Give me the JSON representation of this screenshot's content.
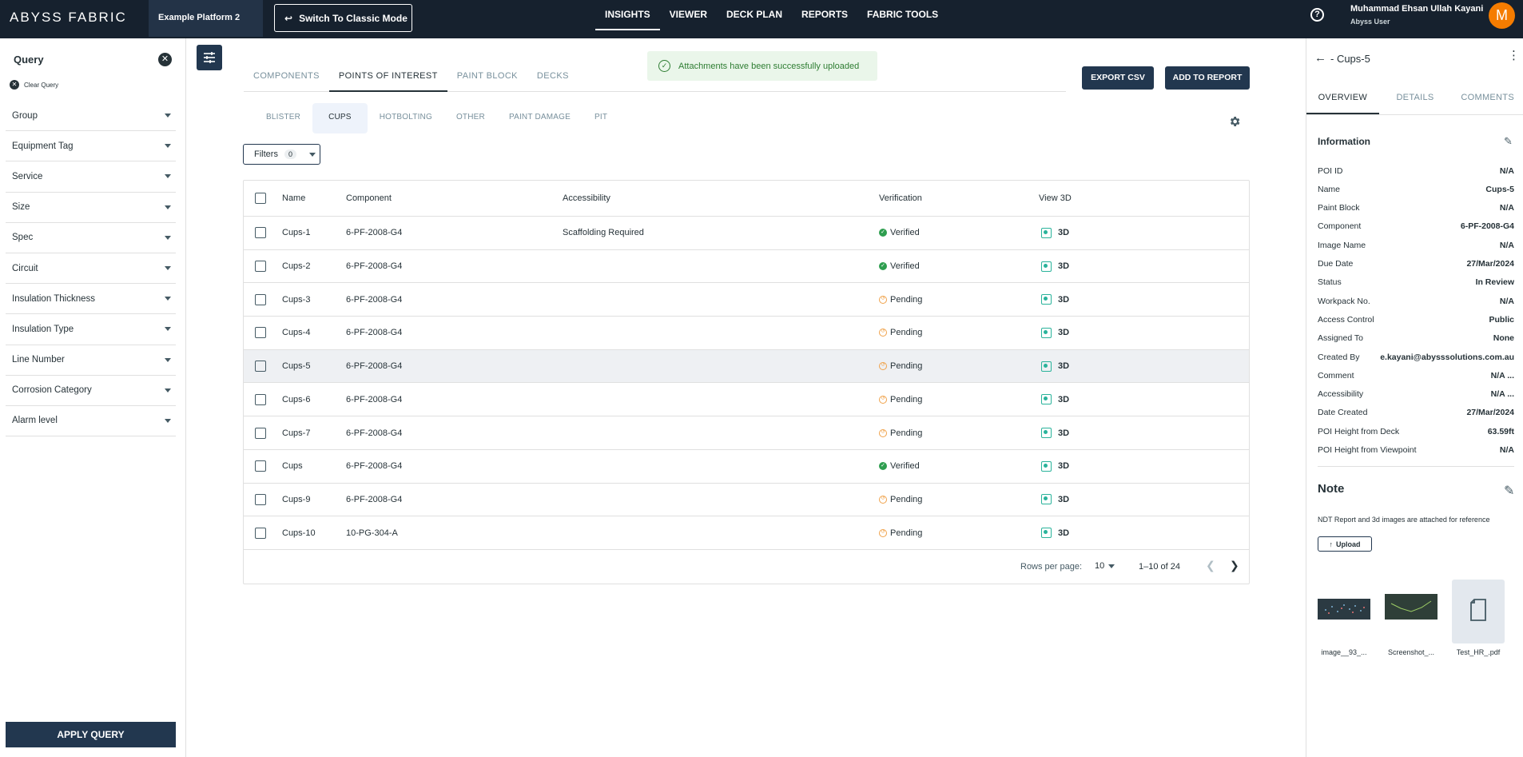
{
  "header": {
    "logo": "ABYSS FABRIC",
    "platform": "Example Platform 2",
    "classic_mode": "Switch To Classic Mode",
    "nav": [
      "INSIGHTS",
      "VIEWER",
      "DECK PLAN",
      "REPORTS",
      "FABRIC TOOLS"
    ],
    "nav_active": "INSIGHTS",
    "help": "?",
    "user_name": "Muhammad Ehsan Ullah Kayani",
    "user_role": "Abyss User",
    "avatar_letter": "M"
  },
  "query": {
    "title": "Query",
    "clear_label": "Clear Query",
    "filters": [
      "Group",
      "Equipment Tag",
      "Service",
      "Size",
      "Spec",
      "Circuit",
      "Insulation Thickness",
      "Insulation Type",
      "Line Number",
      "Corrosion Category",
      "Alarm level"
    ],
    "apply": "APPLY QUERY"
  },
  "main": {
    "tabs": [
      "COMPONENTS",
      "POINTS OF INTEREST",
      "PAINT BLOCK",
      "DECKS"
    ],
    "active_tab": "POINTS OF INTEREST",
    "toast": "Attachments have been successfully uploaded",
    "export_csv": "EXPORT CSV",
    "add_to_report": "ADD TO REPORT",
    "subtabs": [
      "BLISTER",
      "CUPS",
      "HOTBOLTING",
      "OTHER",
      "PAINT DAMAGE",
      "PIT"
    ],
    "active_subtab": "CUPS",
    "filters_label": "Filters",
    "filters_count": "0"
  },
  "table": {
    "columns": [
      "Name",
      "Component",
      "Accessibility",
      "Verification",
      "View 3D"
    ],
    "rows": [
      {
        "name": "Cups-1",
        "component": "6-PF-2008-G4",
        "accessibility": "Scaffolding Required",
        "verification": "Verified",
        "view3d": "3D"
      },
      {
        "name": "Cups-2",
        "component": "6-PF-2008-G4",
        "accessibility": "",
        "verification": "Verified",
        "view3d": "3D"
      },
      {
        "name": "Cups-3",
        "component": "6-PF-2008-G4",
        "accessibility": "",
        "verification": "Pending",
        "view3d": "3D"
      },
      {
        "name": "Cups-4",
        "component": "6-PF-2008-G4",
        "accessibility": "",
        "verification": "Pending",
        "view3d": "3D"
      },
      {
        "name": "Cups-5",
        "component": "6-PF-2008-G4",
        "accessibility": "",
        "verification": "Pending",
        "view3d": "3D"
      },
      {
        "name": "Cups-6",
        "component": "6-PF-2008-G4",
        "accessibility": "",
        "verification": "Pending",
        "view3d": "3D"
      },
      {
        "name": "Cups-7",
        "component": "6-PF-2008-G4",
        "accessibility": "",
        "verification": "Pending",
        "view3d": "3D"
      },
      {
        "name": "Cups",
        "component": "6-PF-2008-G4",
        "accessibility": "",
        "verification": "Verified",
        "view3d": "3D"
      },
      {
        "name": "Cups-9",
        "component": "6-PF-2008-G4",
        "accessibility": "",
        "verification": "Pending",
        "view3d": "3D"
      },
      {
        "name": "Cups-10",
        "component": "10-PG-304-A",
        "accessibility": "",
        "verification": "Pending",
        "view3d": "3D"
      }
    ],
    "selected_row": "Cups-5",
    "pagination": {
      "rows_per_page_label": "Rows per page:",
      "rows_per_page": "10",
      "range": "1–10 of 24"
    }
  },
  "detail": {
    "title": "- Cups-5",
    "tabs": [
      "OVERVIEW",
      "DETAILS",
      "COMMENTS"
    ],
    "active_tab": "OVERVIEW",
    "info_title": "Information",
    "fields": [
      {
        "k": "POI ID",
        "v": "N/A"
      },
      {
        "k": "Name",
        "v": "Cups-5"
      },
      {
        "k": "Paint Block",
        "v": "N/A"
      },
      {
        "k": "Component",
        "v": "6-PF-2008-G4"
      },
      {
        "k": "Image Name",
        "v": "N/A"
      },
      {
        "k": "Due Date",
        "v": "27/Mar/2024"
      },
      {
        "k": "Status",
        "v": "In Review"
      },
      {
        "k": "Workpack No.",
        "v": "N/A"
      },
      {
        "k": "Access Control",
        "v": "Public"
      },
      {
        "k": "Assigned To",
        "v": "None"
      },
      {
        "k": "Created By",
        "v": "e.kayani@abysssolutions.com.au"
      },
      {
        "k": "Comment",
        "v": "N/A ..."
      },
      {
        "k": "Accessibility",
        "v": "N/A ..."
      },
      {
        "k": "Date Created",
        "v": "27/Mar/2024"
      },
      {
        "k": "POI Height from Deck",
        "v": "63.59ft"
      },
      {
        "k": "POI Height from Viewpoint",
        "v": "N/A"
      }
    ],
    "note_title": "Note",
    "note_text": "NDT Report and 3d images are attached for reference",
    "upload": "Upload",
    "attachments": [
      "image__93_...",
      "Screenshot_...",
      "Test_HR_.pdf"
    ]
  },
  "colors": {
    "navy": "#16212e",
    "button": "#22374f",
    "verified": "#2e9e4f",
    "pending": "#f0a24a",
    "toast_bg": "#eaf6ea",
    "accent_3d": "#2ab39b"
  }
}
